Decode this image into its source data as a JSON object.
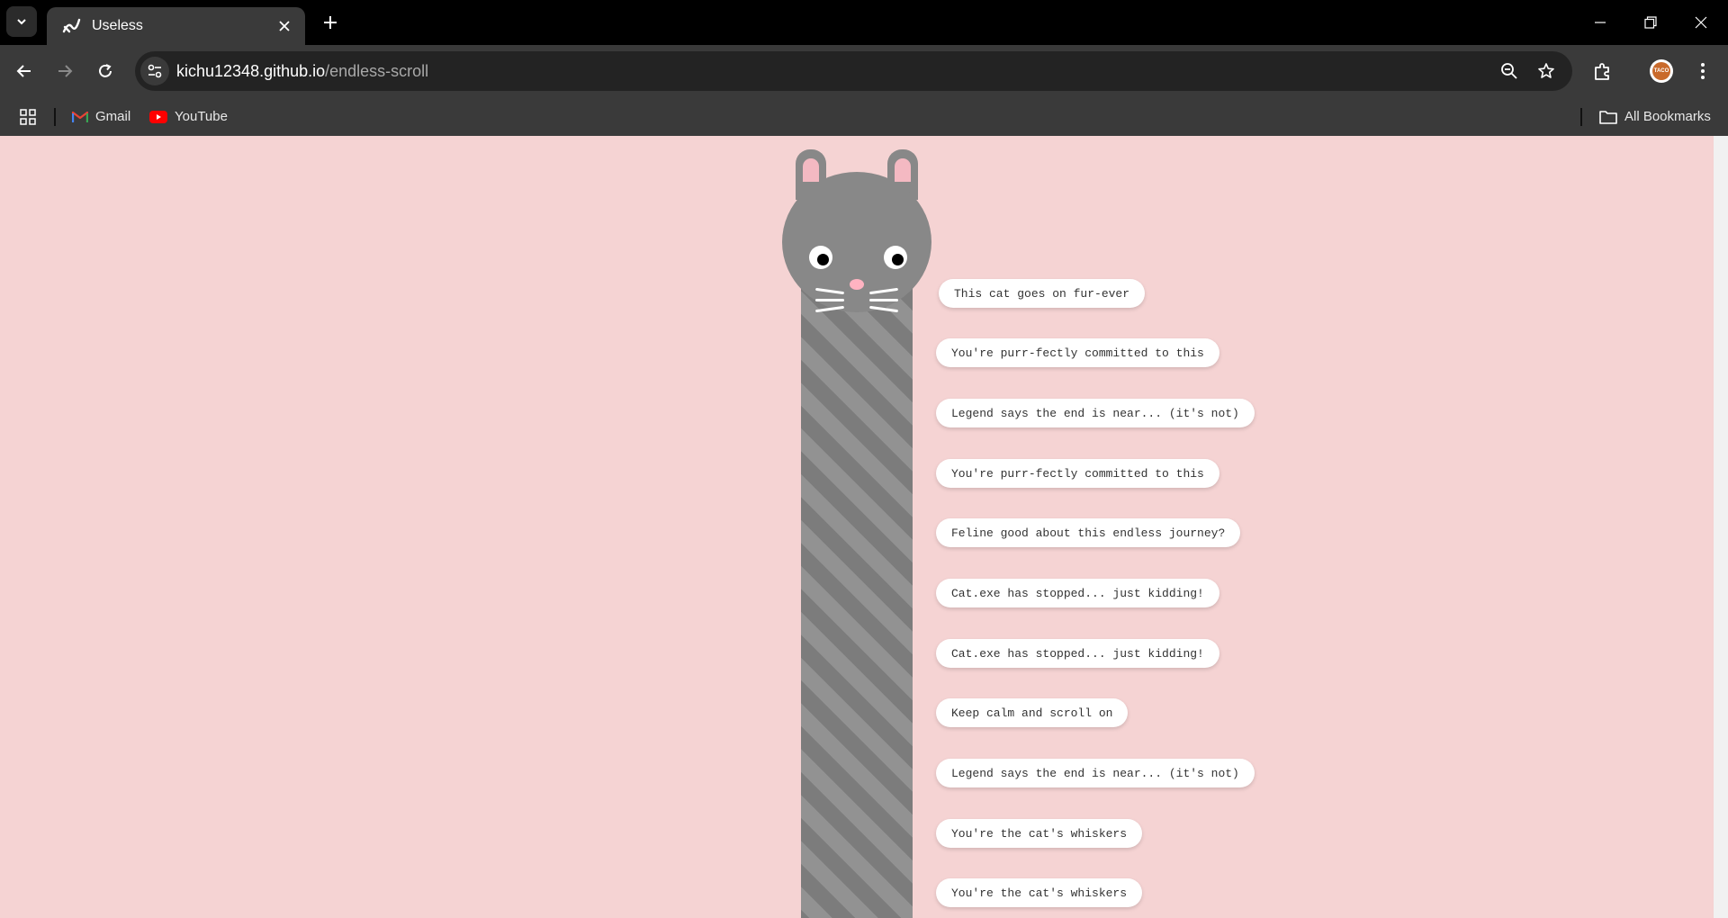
{
  "browser": {
    "tab_title": "Useless",
    "url_host": "kichu12348.github.io",
    "url_path": "/endless-scroll",
    "bookmarks": [
      {
        "label": "Gmail",
        "icon": "gmail-icon"
      },
      {
        "label": "YouTube",
        "icon": "youtube-icon"
      }
    ],
    "all_bookmarks_label": "All Bookmarks",
    "profile_avatar_text": "TACO"
  },
  "page": {
    "background_color": "#f5d3d3",
    "messages": [
      "This cat goes on fur-ever",
      "You're purr-fectly committed to this",
      "Legend says the end is near... (it's not)",
      "You're purr-fectly committed to this",
      "Feline good about this endless journey?",
      "Cat.exe has stopped... just kidding!",
      "Cat.exe has stopped... just kidding!",
      "Keep calm and scroll on",
      "Legend says the end is near... (it's not)",
      "You're the cat's whiskers",
      "You're the cat's whiskers"
    ]
  }
}
